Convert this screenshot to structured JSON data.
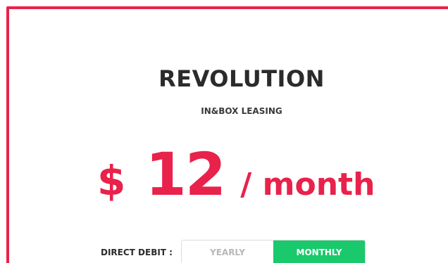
{
  "plan": {
    "title": "REVOLUTION",
    "subtitle": "IN&BOX LEASING"
  },
  "price": {
    "currency": "$",
    "amount": "12",
    "period": "/ month"
  },
  "billing": {
    "label": "DIRECT DEBIT :",
    "options": [
      {
        "label": "YEARLY",
        "selected": false
      },
      {
        "label": "MONTHLY",
        "selected": true
      }
    ]
  },
  "colors": {
    "accent": "#e8224a",
    "selected": "#19c96b",
    "title_text": "#2b2b2b",
    "inactive_text": "#b8b8b8"
  }
}
